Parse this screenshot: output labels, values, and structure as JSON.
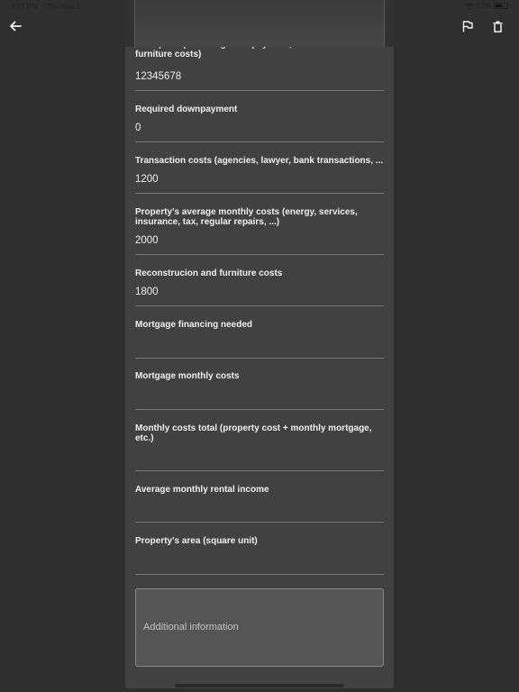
{
  "status_bar": {
    "time": "3:37 PM",
    "date": "Thu Nov 5",
    "battery": "57%",
    "battery_level": 0.57
  },
  "header": {
    "back_icon": "arrow-left-icon",
    "flag_icon": "flag-icon",
    "delete_icon": "trash-icon"
  },
  "form": {
    "fields": [
      {
        "label": "Final price (including downpayment, transaction and furniture costs)",
        "value": "12345678"
      },
      {
        "label": "Required downpayment",
        "value": "0"
      },
      {
        "label": "Transaction costs (agencies, lawyer, bank transactions, ...",
        "value": "1200"
      },
      {
        "label": "Property's average monthly costs (energy, services, insurance, tax, regular repairs, ...)",
        "value": "2000"
      },
      {
        "label": "Reconstrucion and furniture costs",
        "value": "1800"
      },
      {
        "label": "Mortgage financing needed",
        "value": ""
      },
      {
        "label": "Mortgage monthly costs",
        "value": ""
      },
      {
        "label": "Monthly costs total (property cost + monthly mortgage, etc.)",
        "value": ""
      },
      {
        "label": "Average monthly rental income",
        "value": ""
      },
      {
        "label": "Property's area (square unit)",
        "value": ""
      }
    ],
    "additional_info_placeholder": "Additional information"
  }
}
